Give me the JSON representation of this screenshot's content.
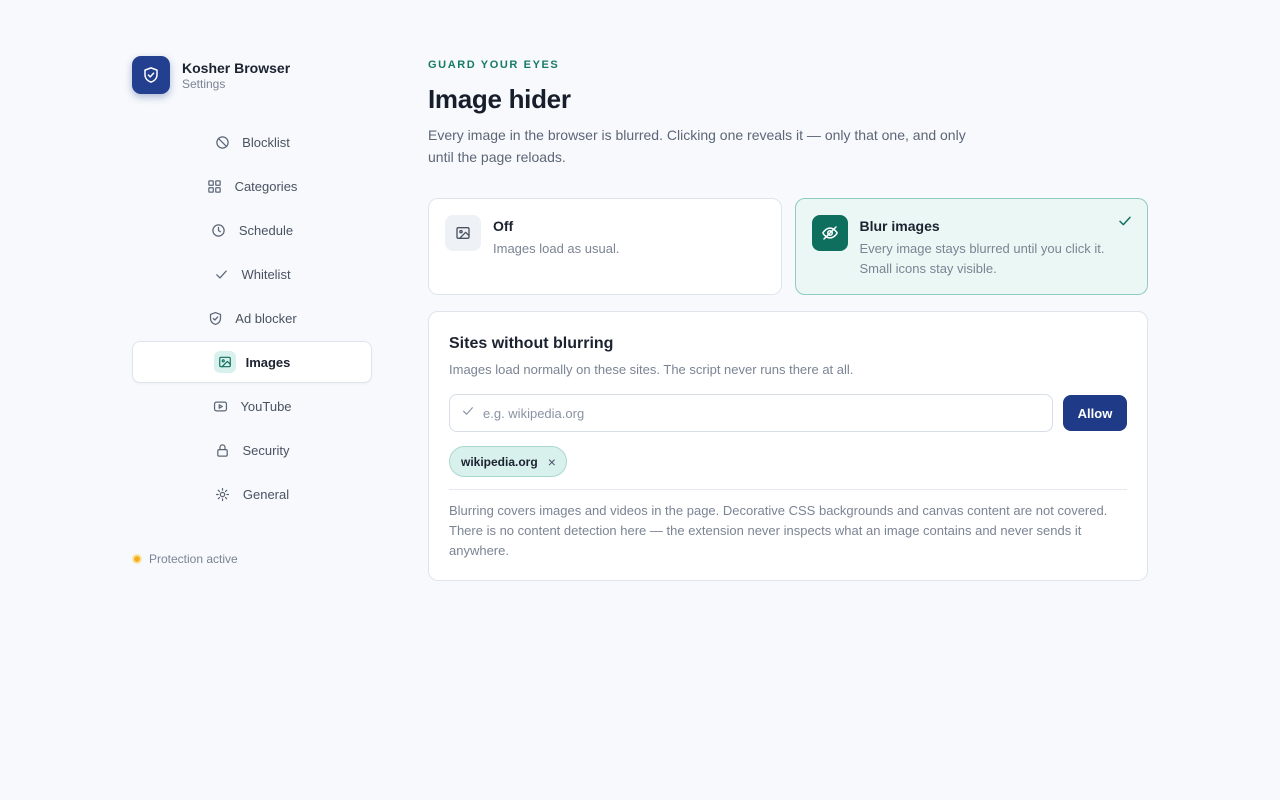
{
  "brand": {
    "name": "Kosher Browser",
    "subtitle": "Settings"
  },
  "sidebar": {
    "items": [
      {
        "label": "Blocklist",
        "icon": "ban-icon"
      },
      {
        "label": "Categories",
        "icon": "grid-icon"
      },
      {
        "label": "Schedule",
        "icon": "clock-icon"
      },
      {
        "label": "Whitelist",
        "icon": "check-icon"
      },
      {
        "label": "Ad blocker",
        "icon": "shield-icon"
      },
      {
        "label": "Images",
        "icon": "image-icon",
        "active": true
      },
      {
        "label": "YouTube",
        "icon": "play-icon"
      },
      {
        "label": "Security",
        "icon": "lock-icon"
      },
      {
        "label": "General",
        "icon": "sun-icon"
      }
    ],
    "status": "Protection active"
  },
  "main": {
    "eyebrow": "GUARD YOUR EYES",
    "title": "Image hider",
    "description": "Every image in the browser is blurred. Clicking one reveals it — only that one, and only until the page reloads.",
    "options": [
      {
        "title": "Off",
        "description": "Images load as usual.",
        "icon": "image-icon",
        "selected": false
      },
      {
        "title": "Blur images",
        "description": "Every image stays blurred until you click it. Small icons stay visible.",
        "icon": "eye-off-icon",
        "selected": true
      }
    ],
    "exceptions": {
      "title": "Sites without blurring",
      "description": "Images load normally on these sites. The script never runs there at all.",
      "input_placeholder": "e.g. wikipedia.org",
      "input_value": "",
      "button_label": "Allow",
      "sites": [
        "wikipedia.org"
      ],
      "remove_glyph": "×",
      "footnote": "Blurring covers images and videos in the page. Decorative CSS backgrounds and canvas content are not covered. There is no content detection here — the extension never inspects what an image contains and never sends it anywhere."
    }
  },
  "colors": {
    "accent": "#0f6f5f",
    "brand": "#233f8f",
    "status": "#f2b01e"
  }
}
